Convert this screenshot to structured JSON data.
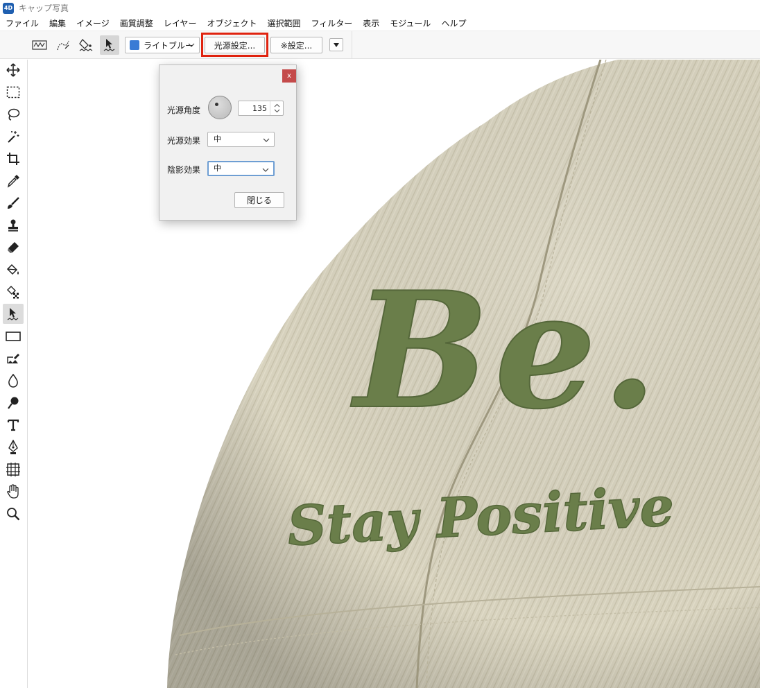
{
  "window": {
    "title": "キャップ写真",
    "app_badge": "4D"
  },
  "menu": [
    "ファイル",
    "編集",
    "イメージ",
    "画質調整",
    "レイヤー",
    "オブジェクト",
    "選択範囲",
    "フィルター",
    "表示",
    "モジュール",
    "ヘルプ"
  ],
  "toolbar": {
    "color_select_value": "ライトブルー",
    "light_settings_label": "光源設定...",
    "texture_settings_label": "※設定..."
  },
  "tools": [
    "move-icon",
    "marquee-select-icon",
    "lasso-icon",
    "magic-wand-icon",
    "crop-icon",
    "eyedropper-icon",
    "brush-icon",
    "stamp-icon",
    "eraser-icon",
    "paint-bucket-icon",
    "pattern-fill-icon",
    "embroidery-select-icon",
    "rectangle-icon",
    "edit-image-icon",
    "blur-drop-icon",
    "dodge-icon",
    "text-icon",
    "pen-icon",
    "grid-transform-icon",
    "hand-icon",
    "zoom-icon"
  ],
  "dialog": {
    "close_glyph": "x",
    "angle_label": "光源角度",
    "angle_value": "135",
    "light_effect_label": "光源効果",
    "light_effect_value": "中",
    "shadow_effect_label": "陰影効果",
    "shadow_effect_value": "中",
    "close_button_label": "閉じる"
  },
  "canvas_art": {
    "main_text": "Be.",
    "sub_text": "Stay Positive"
  },
  "colors": {
    "accent_highlight": "#e0230f",
    "cap_fabric": "#d6d1bd",
    "embroidery": "#6a7e4a",
    "close_button": "#c44a4a",
    "swatch": "#3a7bd5"
  }
}
